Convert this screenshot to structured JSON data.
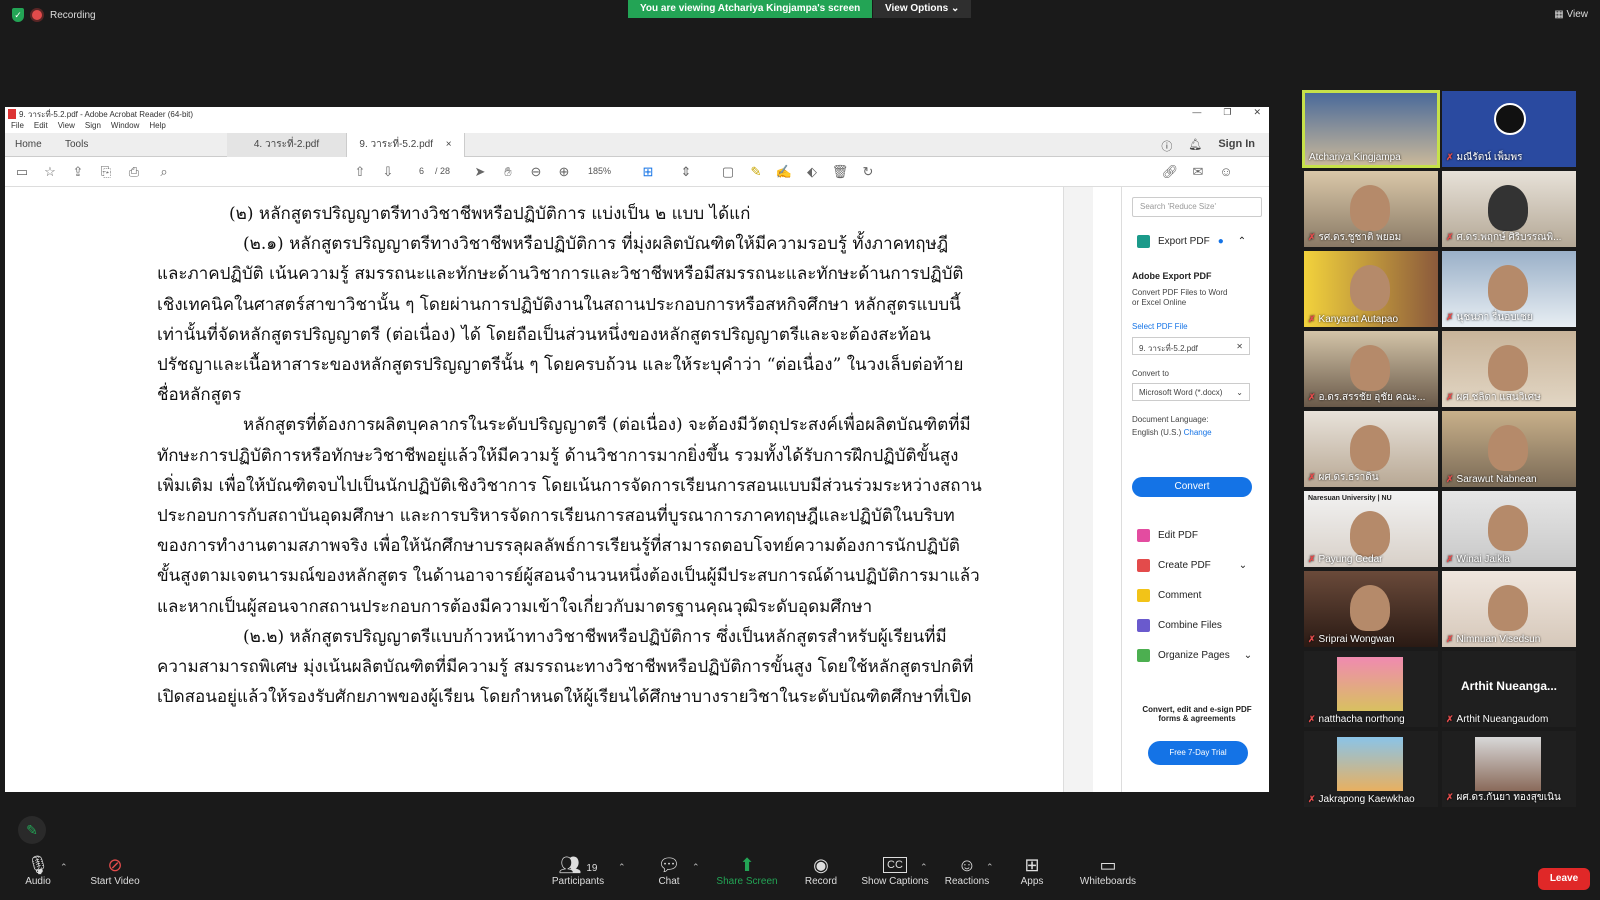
{
  "zoom_meeting": {
    "recording_label": "Recording",
    "viewing_banner": "You are viewing Atchariya Kingjampa's screen",
    "view_options_label": "View Options",
    "view_label": "View",
    "leave_label": "Leave"
  },
  "acrobat": {
    "window_title": "9. วาระที่-5.2.pdf - Adobe Acrobat Reader (64-bit)",
    "menu": [
      "File",
      "Edit",
      "View",
      "Sign",
      "Window",
      "Help"
    ],
    "tabs": {
      "home": "Home",
      "tools": "Tools",
      "doc1": "4. วาระที่-2.pdf",
      "doc2": "9. วาระที่-5.2.pdf",
      "close_glyph": "×"
    },
    "sign_in": "Sign In",
    "page_current": "6",
    "page_total": "/ 28",
    "zoom": "185%",
    "document_lines": [
      "(๒) หลักสูตรปริญญาตรีทางวิชาชีพหรือปฏิบัติการ แบ่งเป็น ๒ แบบ ได้แก่",
      "(๒.๑) หลักสูตรปริญญาตรีทางวิชาชีพหรือปฏิบัติการ ที่มุ่งผลิตบัณฑิตให้มีความรอบรู้ ทั้งภาคทฤษฎี",
      "และภาคปฏิบัติ เน้นความรู้ สมรรถนะและทักษะด้านวิชาการและวิชาชีพหรือมีสมรรถนะและทักษะด้านการปฏิบัติ",
      "เชิงเทคนิคในศาสตร์สาขาวิชานั้น ๆ โดยผ่านการปฏิบัติงานในสถานประกอบการหรือสหกิจศึกษา หลักสูตรแบบนี้",
      "เท่านั้นที่จัดหลักสูตรปริญญาตรี (ต่อเนื่อง) ได้ โดยถือเป็นส่วนหนึ่งของหลักสูตรปริญญาตรีและจะต้องสะท้อน",
      "ปรัชญาและเนื้อหาสาระของหลักสูตรปริญญาตรีนั้น ๆ โดยครบถ้วน และให้ระบุคำว่า “ต่อเนื่อง” ในวงเล็บต่อท้าย",
      "ชื่อหลักสูตร",
      "หลักสูตรที่ต้องการผลิตบุคลากรในระดับปริญญาตรี (ต่อเนื่อง) จะต้องมีวัตถุประสงค์เพื่อผลิตบัณฑิตที่มี",
      "ทักษะการปฏิบัติการหรือทักษะวิชาชีพอยู่แล้วให้มีความรู้ ด้านวิชาการมากยิ่งขึ้น รวมทั้งได้รับการฝึกปฏิบัติขั้นสูง",
      "เพิ่มเติม เพื่อให้บัณฑิตจบไปเป็นนักปฏิบัติเชิงวิชาการ โดยเน้นการจัดการเรียนการสอนแบบมีส่วนร่วมระหว่างสถาน",
      "ประกอบการกับสถาบันอุดมศึกษา และการบริหารจัดการเรียนการสอนที่บูรณาการภาคทฤษฎีและปฏิบัติในบริบท",
      "ของการทำงานตามสภาพจริง เพื่อให้นักศึกษาบรรลุผลลัพธ์การเรียนรู้ที่สามารถตอบโจทย์ความต้องการนักปฏิบัติ",
      "ขั้นสูงตามเจตนารมณ์ของหลักสูตร ในด้านอาจารย์ผู้สอนจำนวนหนึ่งต้องเป็นผู้มีประสบการณ์ด้านปฏิบัติการมาแล้ว",
      "และหากเป็นผู้สอนจากสถานประกอบการต้องมีความเข้าใจเกี่ยวกับมาตรฐานคุณวุฒิระดับอุดมศึกษา",
      "(๒.๒) หลักสูตรปริญญาตรีแบบก้าวหน้าทางวิชาชีพหรือปฏิบัติการ ซึ่งเป็นหลักสูตรสำหรับผู้เรียนที่มี",
      "ความสามารถพิเศษ มุ่งเน้นผลิตบัณฑิตที่มีความรู้ สมรรถนะทางวิชาชีพหรือปฏิบัติการขั้นสูง โดยใช้หลักสูตรปกติที่",
      "เปิดสอนอยู่แล้วให้รองรับศักยภาพของผู้เรียน โดยกำหนดให้ผู้เรียนได้ศึกษาบางรายวิชาในระดับบัณฑิตศึกษาที่เปิด"
    ],
    "right_panel": {
      "search_placeholder": "Search 'Reduce Size'",
      "export_pdf": "Export PDF",
      "adobe_export_title": "Adobe Export PDF",
      "adobe_export_desc1": "Convert PDF Files to Word",
      "adobe_export_desc2": "or Excel Online",
      "select_pdf_label": "Select PDF File",
      "selected_file": "9. วาระที่-5.2.pdf",
      "convert_to_label": "Convert to",
      "convert_to_value": "Microsoft Word (*.docx)",
      "doc_language_label": "Document Language:",
      "doc_language_value": "English (U.S.)",
      "change_link": "Change",
      "convert_button": "Convert",
      "edit_pdf": "Edit PDF",
      "create_pdf": "Create PDF",
      "comment": "Comment",
      "combine_files": "Combine Files",
      "organize_pages": "Organize Pages",
      "promo_line1": "Convert, edit and e-sign PDF",
      "promo_line2": "forms & agreements",
      "trial_button": "Free 7-Day Trial"
    }
  },
  "participants": [
    {
      "name": "Atchariya Kingjampa",
      "muted": false
    },
    {
      "name": "มณีรัตน์ เพ็มพร",
      "muted": true
    },
    {
      "name": "รศ.ดร.ชูชาติ พยอม",
      "muted": true
    },
    {
      "name": "ศ.ดร.พฤกษ์ ศิริบรรณพิ...",
      "muted": true
    },
    {
      "name": "Kanyarat Autapao",
      "muted": true
    },
    {
      "name": "นุชนภา รื่นอบเชย",
      "muted": true
    },
    {
      "name": "อ.ดร.สรรชัย อุชัย คณะ...",
      "muted": true
    },
    {
      "name": "ผศ.ชลิดา แสนวิเศษ",
      "muted": true
    },
    {
      "name": "ผศ.ดร.ธราดิน",
      "muted": true
    },
    {
      "name": "Sarawut Nabnean",
      "muted": true
    },
    {
      "name": "Payung Cedar",
      "muted": true
    },
    {
      "name": "Winai Jaikla",
      "muted": true
    },
    {
      "name": "Sriprai Wongwan",
      "muted": true
    },
    {
      "name": "Nimnuan Visedsun",
      "muted": true
    },
    {
      "name": "natthacha northong",
      "muted": true
    },
    {
      "name": "Arthit Nueangaudom",
      "muted": true
    },
    {
      "name": "Jakrapong Kaewkhao",
      "muted": true
    },
    {
      "name": "ผศ.ดร.กันยา ทองสุขเนิน",
      "muted": true
    }
  ],
  "tile_extra": {
    "arthit_big": "Arthit Nueanga...",
    "nu_banner": "Naresuan University | NU"
  },
  "bottom_bar": {
    "audio": "Audio",
    "start_video": "Start Video",
    "participants": "Participants",
    "participants_count": "19",
    "chat": "Chat",
    "share_screen": "Share Screen",
    "record": "Record",
    "show_captions": "Show Captions",
    "reactions": "Reactions",
    "apps": "Apps",
    "whiteboards": "Whiteboards",
    "cc_glyph": "CC"
  },
  "colors": {
    "zoom_green": "#23a455",
    "leave_red": "#e02828",
    "acrobat_blue": "#1473e6",
    "speaker_highlight": "#c6e14a"
  }
}
